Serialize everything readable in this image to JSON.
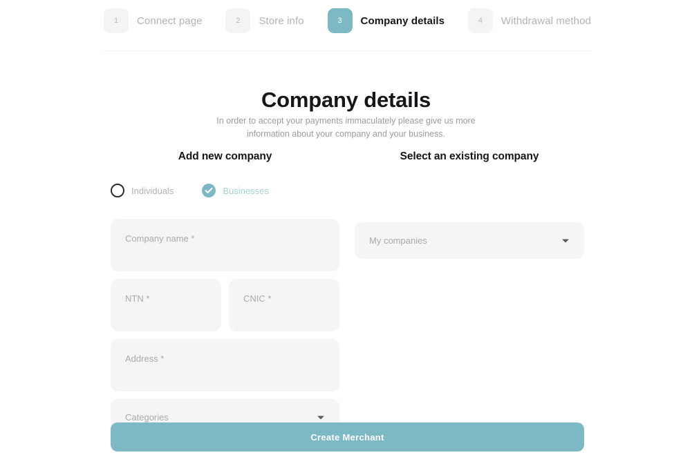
{
  "stepper": {
    "steps": [
      {
        "number": "1",
        "label": "Connect page",
        "active": false
      },
      {
        "number": "2",
        "label": "Store info",
        "active": false
      },
      {
        "number": "3",
        "label": "Company details",
        "active": true
      },
      {
        "number": "4",
        "label": "Withdrawal method",
        "active": false
      }
    ]
  },
  "header": {
    "title": "Company details",
    "subtitle": "In order to accept your payments immaculately please give us more information about your company and your business."
  },
  "left_column": {
    "heading": "Add new company",
    "radios": [
      {
        "label": "Individuals",
        "selected": false
      },
      {
        "label": "Businesses",
        "selected": true
      }
    ],
    "fields": {
      "company_name": {
        "placeholder": "Company name *",
        "value": ""
      },
      "ntn": {
        "placeholder": "NTN *",
        "value": ""
      },
      "cnic": {
        "placeholder": "CNIC *",
        "value": ""
      },
      "address": {
        "placeholder": "Address *",
        "value": ""
      },
      "categories": {
        "placeholder": "Categories",
        "value": ""
      }
    }
  },
  "right_column": {
    "heading": "Select an existing company",
    "fields": {
      "my_companies": {
        "placeholder": "My companies",
        "value": ""
      }
    }
  },
  "actions": {
    "submit_label": "Create Merchant"
  },
  "colors": {
    "accent": "#7cb9c5",
    "field_bg": "#f5f5f5",
    "badge_bg": "#f4f4f5",
    "muted_text": "#a9a9af",
    "divider": "#f2f2f3"
  }
}
